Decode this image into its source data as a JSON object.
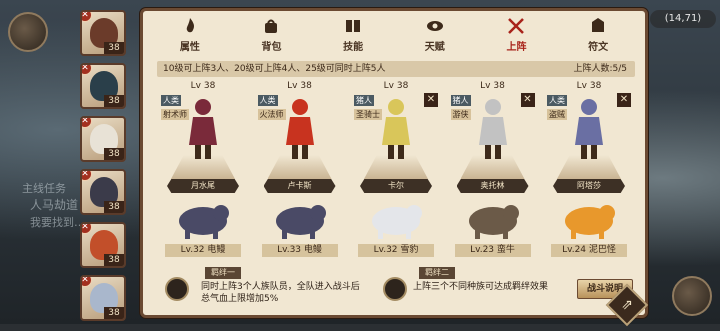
{
  "coords_text": "(14,71)",
  "left_bg": {
    "quest_title": "主线任务",
    "quest_line": "人马劫道",
    "quest_sub": "我要找到…"
  },
  "roster": [
    {
      "level": "38",
      "face_color": "#6b3b2a"
    },
    {
      "level": "38",
      "face_color": "#2a3f4a"
    },
    {
      "level": "38",
      "face_color": "#e8e2d6"
    },
    {
      "level": "38",
      "face_color": "#3b3b4a"
    },
    {
      "level": "38",
      "face_color": "#c24f2a"
    },
    {
      "level": "38",
      "face_color": "#a9b7cc"
    }
  ],
  "tabs": [
    {
      "label": "属性",
      "icon": "flame-icon",
      "active": false
    },
    {
      "label": "背包",
      "icon": "bag-icon",
      "active": false
    },
    {
      "label": "技能",
      "icon": "book-icon",
      "active": false
    },
    {
      "label": "天赋",
      "icon": "eye-icon",
      "active": false
    },
    {
      "label": "上阵",
      "icon": "swords-icon",
      "active": true
    },
    {
      "label": "符文",
      "icon": "rune-icon",
      "active": false
    }
  ],
  "deploy_rule": "10级可上阵3人、20级可上阵4人、25级可同时上阵5人",
  "deploy_count": "上阵人数:5/5",
  "heroes": [
    {
      "level": "Lv 38",
      "race": "人类",
      "class": "射术师",
      "name": "月水尾",
      "color": "#7a2a3a",
      "removable": false
    },
    {
      "level": "Lv 38",
      "race": "人类",
      "class": "火法师",
      "name": "卢卡斯",
      "color": "#c8331f",
      "removable": false
    },
    {
      "level": "Lv 38",
      "race": "猪人",
      "class": "圣骑士",
      "name": "卡尔",
      "color": "#d9c65a",
      "removable": true
    },
    {
      "level": "Lv 38",
      "race": "猪人",
      "class": "游侠",
      "name": "奥托林",
      "color": "#c2c2c2",
      "removable": true
    },
    {
      "level": "Lv 38",
      "race": "人类",
      "class": "盗贼",
      "name": "阿塔莎",
      "color": "#6a6fa3",
      "removable": true
    }
  ],
  "pets": [
    {
      "name": "Lv.32 电鳗",
      "color": "#4a4a66"
    },
    {
      "name": "Lv.33 电鳗",
      "color": "#4a4a66"
    },
    {
      "name": "Lv.32 雪豹",
      "color": "#e4e6ea"
    },
    {
      "name": "Lv.23 蛮牛",
      "color": "#6b5a48"
    },
    {
      "name": "Lv.24 泥巴怪",
      "color": "#e8982c"
    }
  ],
  "bonds": [
    {
      "title": "羁绊一",
      "desc_line1": "同时上阵3个人族队员，全队进入战斗后",
      "desc_line2": "总气血上限增加5%"
    },
    {
      "title": "羁绊二",
      "desc_line1": "上阵三个不同种族可达成羁绊效果",
      "desc_line2": ""
    }
  ],
  "battle_button": "战斗说明",
  "close_symbol": "⇗"
}
